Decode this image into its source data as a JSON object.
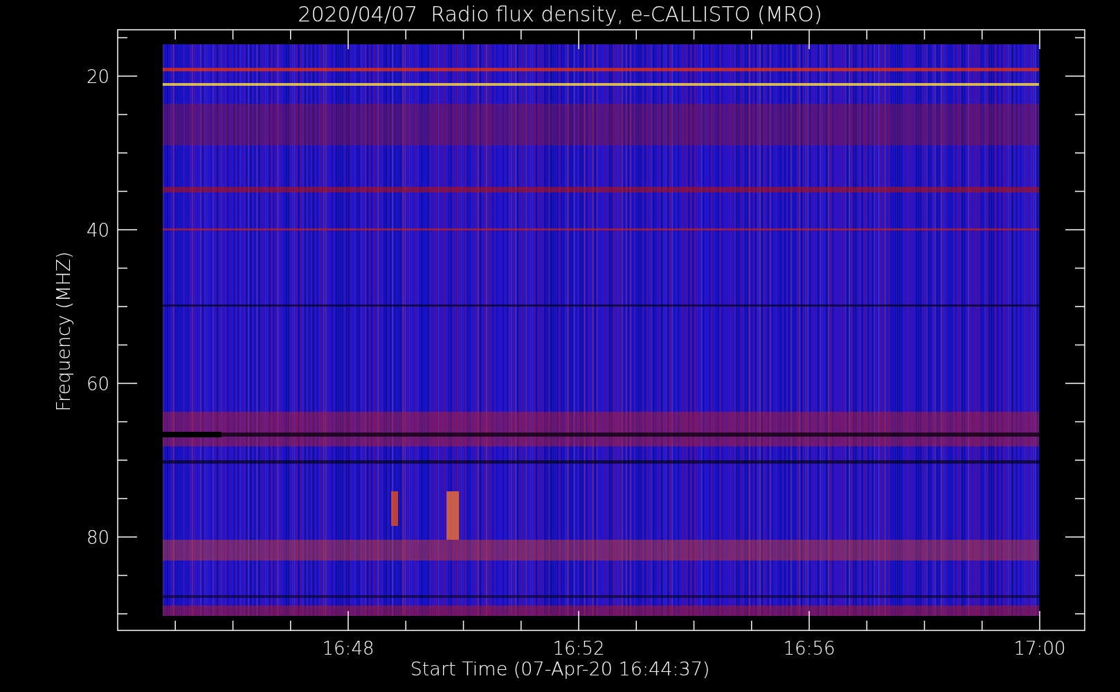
{
  "title": "2020/04/07  Radio flux density, e-CALLISTO (MRO)",
  "y_axis": {
    "label": "Frequency (MHZ)",
    "ticks": [
      "20",
      "40",
      "60",
      "80"
    ]
  },
  "x_axis": {
    "label": "Start Time (07-Apr-20 16:44:37)",
    "ticks": [
      "16:48",
      "16:52",
      "16:56",
      "17:00"
    ]
  }
}
